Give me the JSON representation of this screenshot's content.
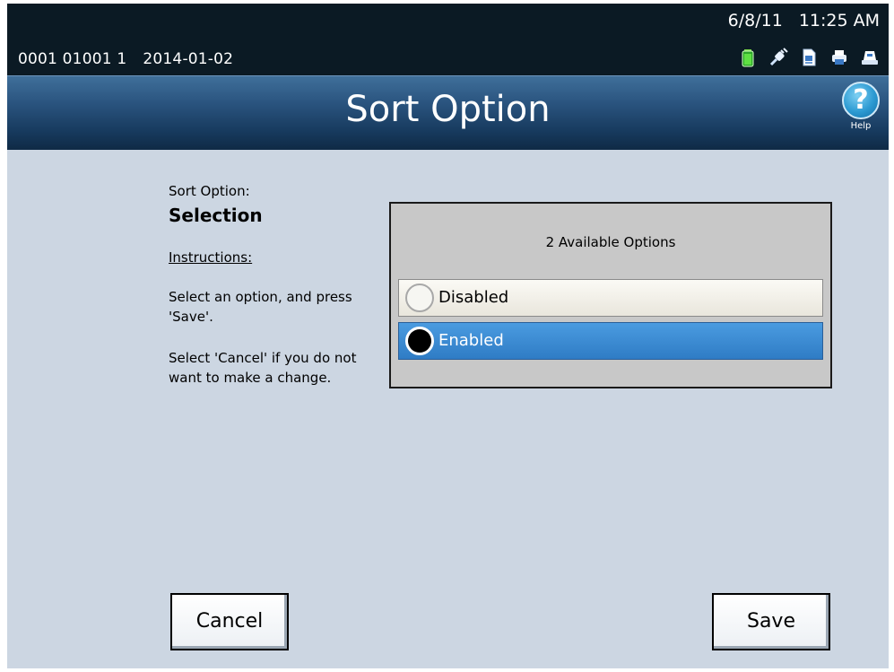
{
  "status_bar": {
    "meter_id": "0001 01001 1",
    "meter_date": "2014-01-02",
    "date": "6/8/11",
    "time": "11:25 AM",
    "icons": [
      "battery-icon",
      "power-plug-icon",
      "document-icon",
      "printer-icon",
      "scale-icon"
    ]
  },
  "header": {
    "title": "Sort Option",
    "help_label": "Help",
    "help_symbol": "?"
  },
  "sidebar": {
    "label": "Sort Option:",
    "heading": "Selection",
    "instructions_heading": "Instructions:",
    "instruction_1": "Select an option, and press 'Save'.",
    "instruction_2": "Select 'Cancel' if you do not want to make a change."
  },
  "options": {
    "count_text": "2 Available Options",
    "items": [
      {
        "label": "Disabled",
        "selected": false
      },
      {
        "label": "Enabled",
        "selected": true
      }
    ]
  },
  "buttons": {
    "cancel": "Cancel",
    "save": "Save"
  },
  "colors": {
    "header_blue": "#2b5580",
    "content_bg": "#ccd6e2",
    "selected_blue": "#3b8bd3"
  }
}
